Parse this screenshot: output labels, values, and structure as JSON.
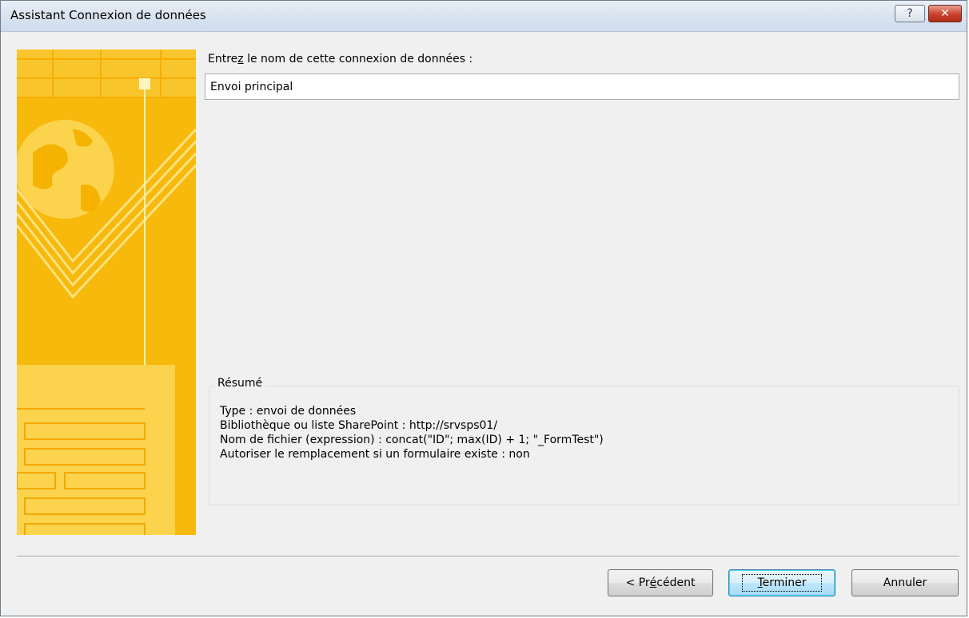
{
  "window": {
    "title": "Assistant Connexion de données",
    "help_glyph": "?",
    "close_glyph": "✕"
  },
  "form": {
    "name_label_before": "Entre",
    "name_label_accel": "z",
    "name_label_after": " le nom de cette connexion de données :",
    "name_value": "Envoi principal"
  },
  "summary": {
    "legend": "Résumé",
    "lines": [
      "Type : envoi de données",
      "Bibliothèque ou liste SharePoint : http://srvsps01/",
      "Nom de fichier (expression) : concat(\"ID\"; max(ID) + 1; \"_FormTest\")",
      "Autoriser le remplacement si un formulaire existe : non"
    ]
  },
  "buttons": {
    "prev_before": "< Pr",
    "prev_accel": "é",
    "prev_after": "cédent",
    "finish_accel": "T",
    "finish_after": "erminer",
    "cancel": "Annuler"
  },
  "colors": {
    "banner_base": "#f7b90c",
    "banner_light": "#fcd55a",
    "banner_dark": "#f2a900"
  }
}
